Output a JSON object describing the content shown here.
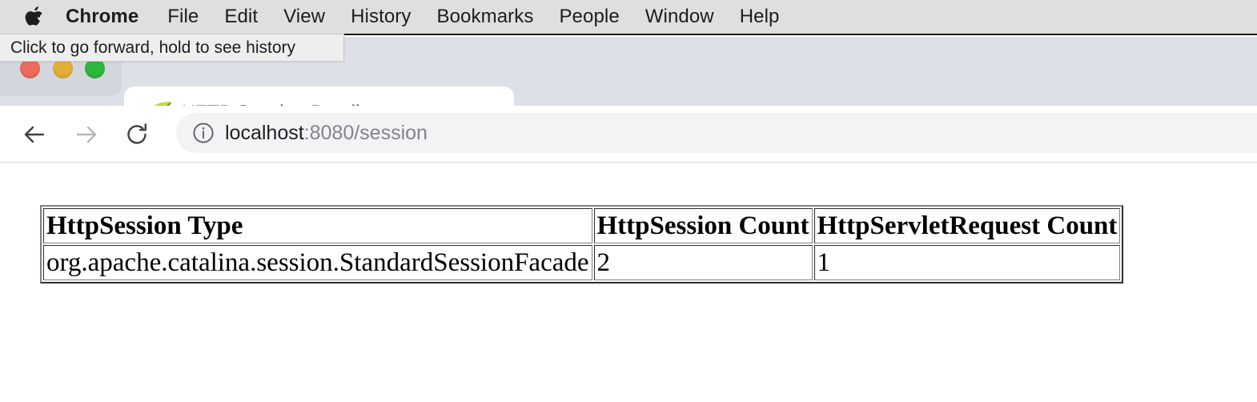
{
  "menubar": {
    "apple_icon": "apple-logo-icon",
    "items": [
      {
        "label": "Chrome",
        "bold": true
      },
      {
        "label": "File"
      },
      {
        "label": "Edit"
      },
      {
        "label": "View"
      },
      {
        "label": "History"
      },
      {
        "label": "Bookmarks"
      },
      {
        "label": "People"
      },
      {
        "label": "Window"
      },
      {
        "label": "Help"
      }
    ]
  },
  "tooltip": {
    "text": "Click to go forward, hold to see history"
  },
  "window_controls": {
    "close": {
      "name": "close-window-button",
      "color": "#ed6a5e"
    },
    "minimize": {
      "name": "minimize-window-button",
      "color": "#e3ae38"
    },
    "maximize": {
      "name": "maximize-window-button",
      "color": "#2fb63c"
    }
  },
  "tabstrip": {
    "tab": {
      "title": "HTTP Session Details",
      "favicon": "spring-leaf-icon",
      "close_label": "×"
    },
    "new_tab_label": "+"
  },
  "toolbar": {
    "back_icon": "arrow-left-icon",
    "forward_icon": "arrow-right-icon",
    "reload_icon": "reload-icon",
    "omnibox": {
      "security_icon": "info-circle-icon",
      "url_host": "localhost",
      "url_rest": ":8080/session"
    }
  },
  "page": {
    "table": {
      "headers": [
        "HttpSession Type",
        "HttpSession Count",
        "HttpServletRequest Count"
      ],
      "rows": [
        [
          "org.apache.catalina.session.StandardSessionFacade",
          "2",
          "1"
        ]
      ]
    }
  }
}
